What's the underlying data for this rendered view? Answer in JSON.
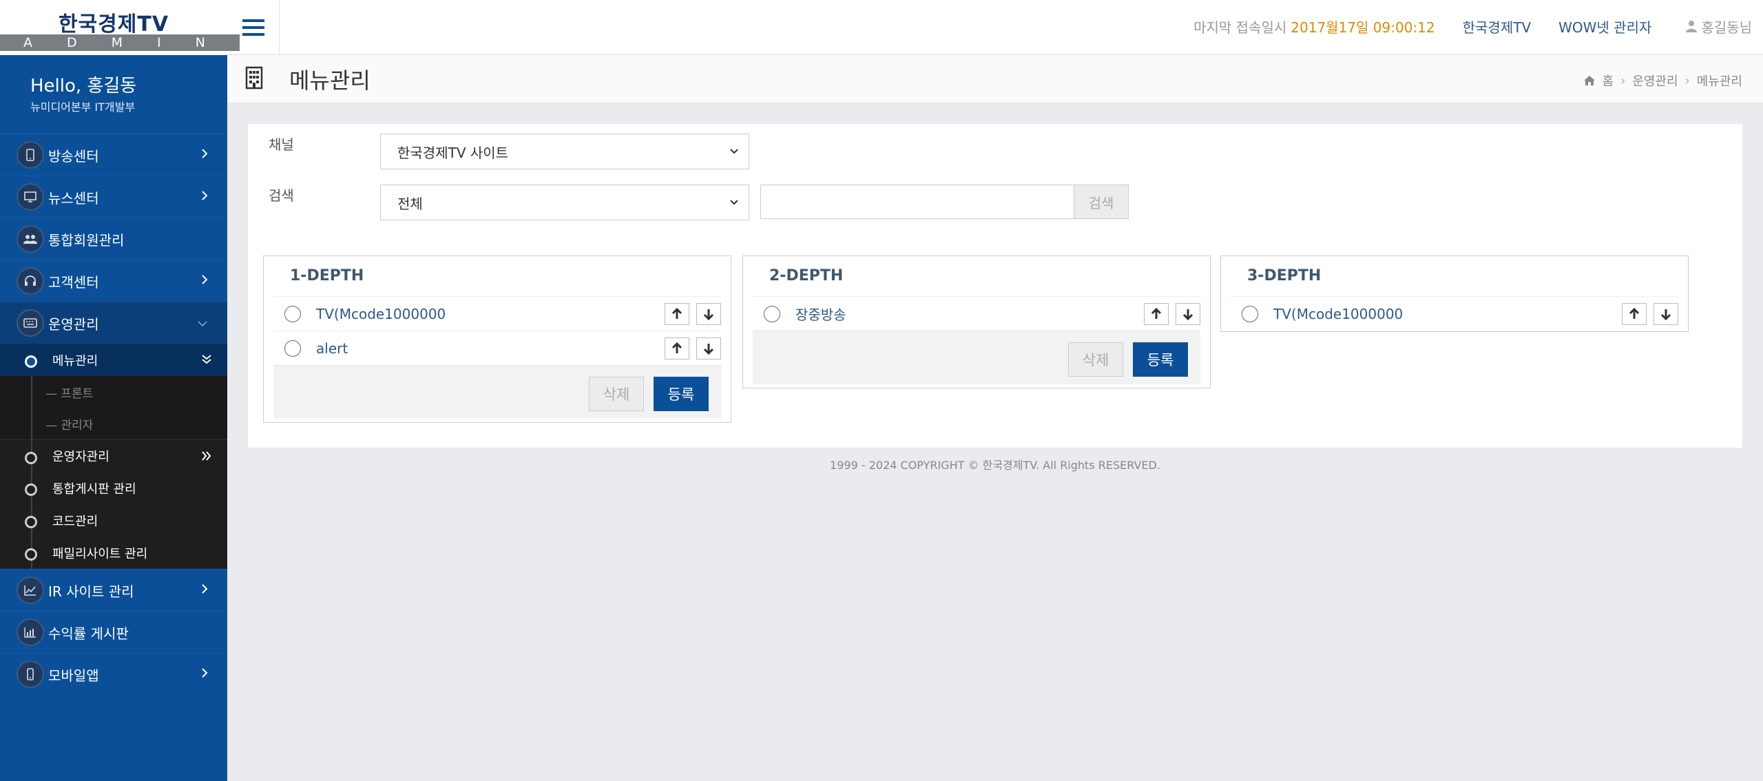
{
  "header": {
    "logo_text": "한국경제TV",
    "logo_sub": "ADMIN",
    "last_login_label": "마지막 접속일시",
    "last_login_value": "2017월17일 09:00:12",
    "links": [
      "한국경제TV",
      "WOW넷 관리자"
    ],
    "user_label": "홍길동님"
  },
  "sidebar": {
    "greeting": "Hello, 홍길동",
    "department": "뉴미디어본부 IT개발부",
    "items": [
      {
        "label": "방송센터",
        "icon": "tablet-icon",
        "has_arrow": true
      },
      {
        "label": "뉴스센터",
        "icon": "monitor-icon",
        "has_arrow": true
      },
      {
        "label": "통합회원관리",
        "icon": "users-icon",
        "has_arrow": false
      },
      {
        "label": "고객센터",
        "icon": "headset-icon",
        "has_arrow": true
      },
      {
        "label": "운영관리",
        "icon": "keyboard-icon",
        "has_arrow": true,
        "expanded": true
      }
    ],
    "sub_items": [
      {
        "label": "메뉴관리",
        "active": true
      },
      {
        "label": "운영자관리"
      },
      {
        "label": "통합게시판 관리"
      },
      {
        "label": "코드관리"
      },
      {
        "label": "패밀리사이트 관리"
      }
    ],
    "sub_sub_items": [
      "프론트",
      "관리자"
    ],
    "items_after": [
      {
        "label": "IR 사이트 관리",
        "icon": "chart-line-icon",
        "has_arrow": true
      },
      {
        "label": "수익률 게시판",
        "icon": "bar-chart-icon",
        "has_arrow": false
      },
      {
        "label": "모바일앱",
        "icon": "mobile-icon",
        "has_arrow": true
      }
    ]
  },
  "page": {
    "title": "메뉴관리",
    "breadcrumb": [
      "홈",
      "운영관리",
      "메뉴관리"
    ]
  },
  "form": {
    "channel_label": "채널",
    "channel_value": "한국경제TV 사이트",
    "search_label": "검색",
    "search_select_value": "전체",
    "search_input_value": "",
    "search_button": "검색"
  },
  "depths": [
    {
      "title": "1-DEPTH",
      "items": [
        "TV(Mcode1000000",
        "alert"
      ],
      "delete_label": "삭제",
      "register_label": "등록"
    },
    {
      "title": "2-DEPTH",
      "items": [
        "장중방송"
      ],
      "delete_label": "삭제",
      "register_label": "등록"
    },
    {
      "title": "3-DEPTH",
      "items": [
        "TV(Mcode1000000"
      ]
    }
  ],
  "footer": "1999 - 2024 COPYRIGHT © 한국경제TV. All Rights RESERVED.",
  "colors": {
    "sidebar": "#0b4f99",
    "accent_orange": "#e08a00",
    "link": "#2b5a8c"
  }
}
